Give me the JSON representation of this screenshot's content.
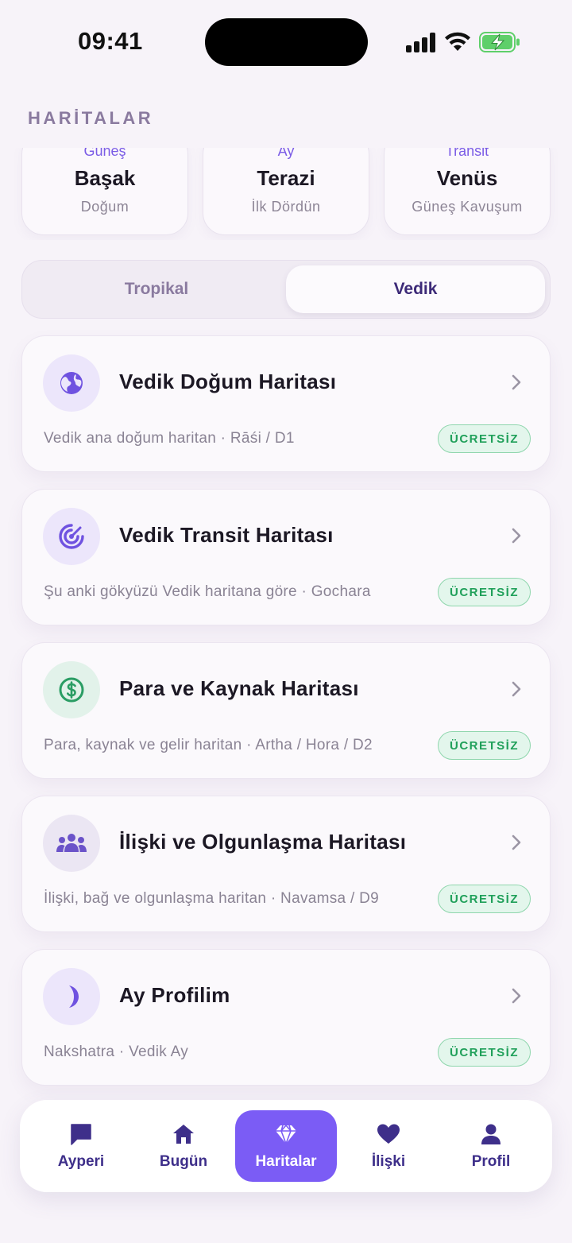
{
  "status_bar": {
    "time": "09:41"
  },
  "section_title": "HARİTALAR",
  "summary_cards": [
    {
      "label": "Güneş",
      "value": "Başak",
      "sub": "Doğum"
    },
    {
      "label": "Ay",
      "value": "Terazi",
      "sub": "İlk Dördün"
    },
    {
      "label": "Transit",
      "value": "Venüs",
      "sub": "Güneş Kavuşum"
    }
  ],
  "segment": {
    "left": "Tropikal",
    "right": "Vedik",
    "selected": "Vedik"
  },
  "charts": [
    {
      "icon": "globe-icon",
      "title": "Vedik Doğum Haritası",
      "desc": "Vedik ana doğum haritan · Rāśi / D1",
      "badge": "ÜCRETSİZ",
      "icon_bg": "#ece6fb",
      "icon_color": "#6f52e0"
    },
    {
      "icon": "radar-icon",
      "title": "Vedik Transit Haritası",
      "desc": "Şu anki gökyüzü Vedik haritana göre · Gochara",
      "badge": "ÜCRETSİZ",
      "icon_bg": "#ece6fb",
      "icon_color": "#6f52e0"
    },
    {
      "icon": "dollar-icon",
      "title": "Para ve Kaynak Haritası",
      "desc": "Para, kaynak ve gelir haritan · Artha / Hora / D2",
      "badge": "ÜCRETSİZ",
      "icon_bg": "#e2f2ea",
      "icon_color": "#2a9d64"
    },
    {
      "icon": "people-icon",
      "title": "İlişki ve Olgunlaşma Haritası",
      "desc": "İlişki, bağ ve olgunlaşma haritan · Navamsa / D9",
      "badge": "ÜCRETSİZ",
      "icon_bg": "#ebe6f3",
      "icon_color": "#6b53c9"
    },
    {
      "icon": "moon-icon",
      "title": "Ay Profilim",
      "desc": "Nakshatra · Vedik Ay",
      "badge": "ÜCRETSİZ",
      "icon_bg": "#ece6fb",
      "icon_color": "#6f52e0"
    }
  ],
  "bottom_nav": [
    {
      "label": "Ayperi",
      "icon": "chat-icon",
      "active": false
    },
    {
      "label": "Bugün",
      "icon": "home-icon",
      "active": false
    },
    {
      "label": "Haritalar",
      "icon": "diamond-icon",
      "active": true
    },
    {
      "label": "İlişki",
      "icon": "heart-icon",
      "active": false
    },
    {
      "label": "Profil",
      "icon": "person-icon",
      "active": false
    }
  ],
  "colors": {
    "accent": "#7b5cf5",
    "free_badge": "#20a05a",
    "nav_text": "#3e2f8a"
  }
}
